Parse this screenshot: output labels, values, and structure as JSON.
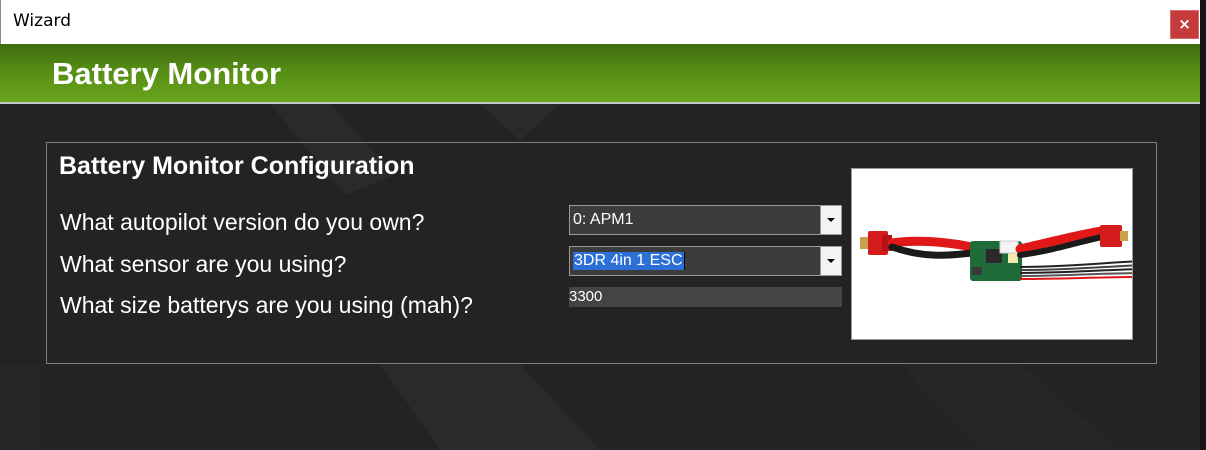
{
  "window": {
    "title": "Wizard",
    "close_label": "×"
  },
  "header": {
    "title": "Battery Monitor"
  },
  "config": {
    "group_title": "Battery Monitor Configuration",
    "autopilot": {
      "question": "What autopilot version do you own?",
      "selected": "0: APM1"
    },
    "sensor": {
      "question": "What sensor are you using?",
      "selected": "3DR 4in 1 ESC"
    },
    "battery": {
      "question": "What size batterys are you using (mah)?",
      "value": "3300"
    }
  },
  "image": {
    "icon": "battery-monitor-module-image"
  },
  "colors": {
    "header_green": "#5a9417",
    "background": "#232325",
    "close_red": "#c53a3a",
    "selection_blue": "#2c6fd6",
    "cable_red": "#e01818"
  }
}
